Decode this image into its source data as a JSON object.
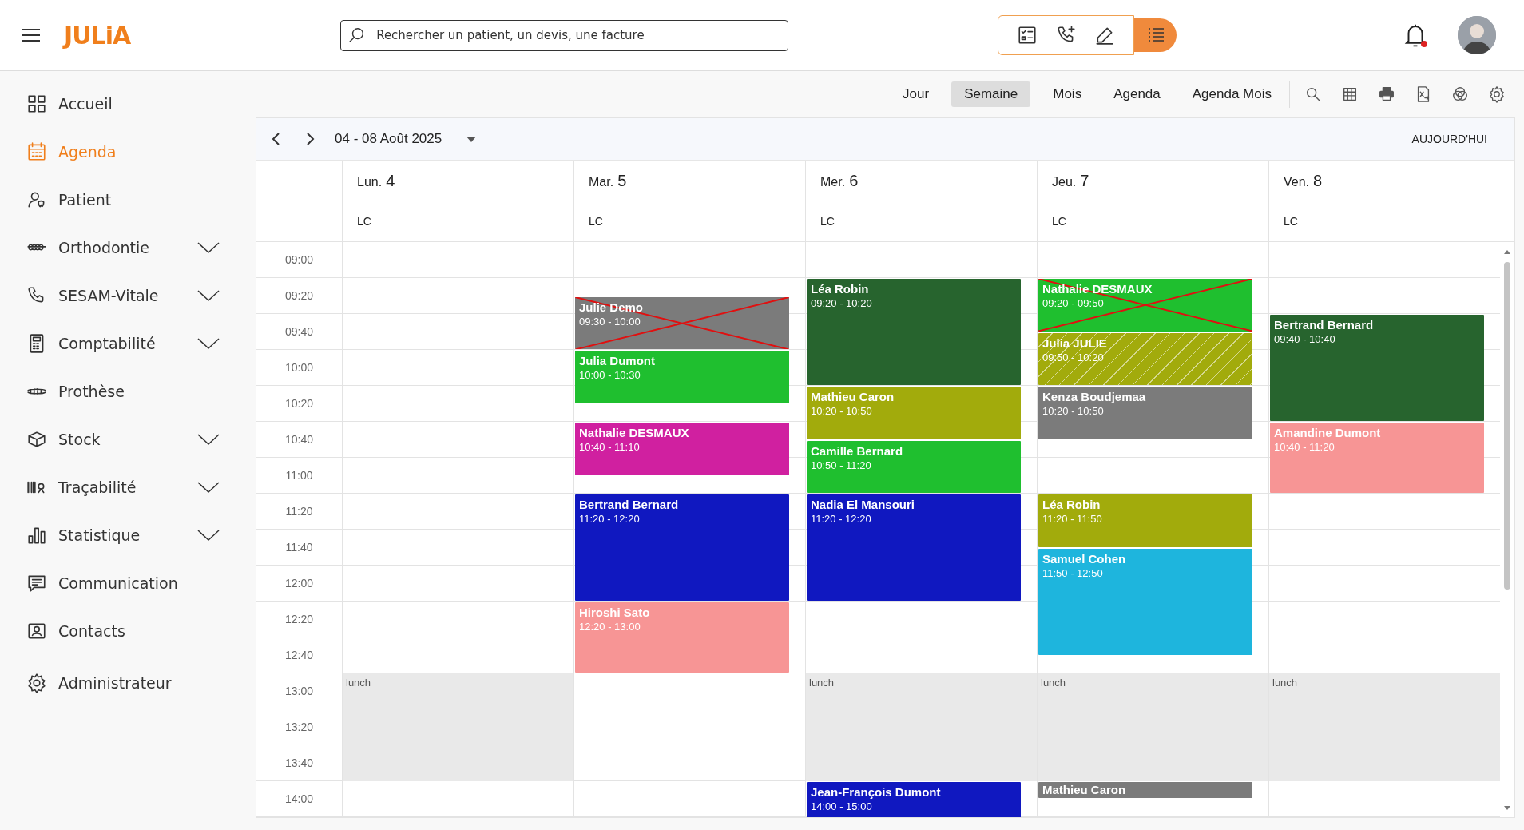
{
  "header": {
    "logo": "JULiA",
    "search": {
      "placeholder": "Rechercher un patient, un devis, une facture"
    },
    "notification_dot": true
  },
  "sidebar": {
    "items": [
      {
        "label": "Accueil",
        "selected": false,
        "expandable": false
      },
      {
        "label": "Agenda",
        "selected": true,
        "expandable": false
      },
      {
        "label": "Patient",
        "selected": false,
        "expandable": false
      },
      {
        "label": "Orthodontie",
        "selected": false,
        "expandable": true
      },
      {
        "label": "SESAM-Vitale",
        "selected": false,
        "expandable": true
      },
      {
        "label": "Comptabilité",
        "selected": false,
        "expandable": true
      },
      {
        "label": "Prothèse",
        "selected": false,
        "expandable": false
      },
      {
        "label": "Stock",
        "selected": false,
        "expandable": true
      },
      {
        "label": "Traçabilité",
        "selected": false,
        "expandable": true
      },
      {
        "label": "Statistique",
        "selected": false,
        "expandable": true
      },
      {
        "label": "Communication",
        "selected": false,
        "expandable": false
      },
      {
        "label": "Contacts",
        "selected": false,
        "expandable": false
      }
    ],
    "footer_items": [
      {
        "label": "Administrateur",
        "selected": false,
        "expandable": false
      }
    ]
  },
  "views": [
    {
      "label": "Jour",
      "selected": false
    },
    {
      "label": "Semaine",
      "selected": true
    },
    {
      "label": "Mois",
      "selected": false
    },
    {
      "label": "Agenda",
      "selected": false
    },
    {
      "label": "Agenda Mois",
      "selected": false
    }
  ],
  "nav": {
    "range": "04 - 08 Août 2025",
    "today": "AUJOURD'HUI"
  },
  "calendar": {
    "times": [
      "09:00",
      "09:20",
      "09:40",
      "10:00",
      "10:20",
      "10:40",
      "11:00",
      "11:20",
      "11:40",
      "12:00",
      "12:20",
      "12:40",
      "13:00",
      "13:20",
      "13:40",
      "14:00"
    ],
    "days": [
      {
        "weekday": "Lun.",
        "date": "4",
        "resource": "LC",
        "lunch": "lunch"
      },
      {
        "weekday": "Mar.",
        "date": "5",
        "resource": "LC",
        "events": [
          {
            "name": "Julie Demo",
            "time": "09:30 - 10:00",
            "color": "#7b7b7b",
            "cancelled": true,
            "hatched": false
          },
          {
            "name": "Julia Dumont",
            "time": "10:00 - 10:30",
            "color": "#1fbf2f",
            "cancelled": false,
            "hatched": false
          },
          {
            "name": "Nathalie DESMAUX",
            "time": "10:40 - 11:10",
            "color": "#d020a0",
            "cancelled": false,
            "hatched": false
          },
          {
            "name": "Bertrand Bernard",
            "time": "11:20 - 12:20",
            "color": "#1018c0",
            "cancelled": false,
            "hatched": false
          },
          {
            "name": "Hiroshi Sato",
            "time": "12:20 - 13:00",
            "color": "#f79595",
            "cancelled": false,
            "hatched": false
          }
        ]
      },
      {
        "weekday": "Mer.",
        "date": "6",
        "resource": "LC",
        "lunch": "lunch",
        "events": [
          {
            "name": "Léa Robin",
            "time": "09:20 - 10:20",
            "color": "#27642e",
            "cancelled": false,
            "hatched": false
          },
          {
            "name": "Mathieu Caron",
            "time": "10:20 - 10:50",
            "color": "#a2ab0c",
            "cancelled": false,
            "hatched": false
          },
          {
            "name": "Camille Bernard",
            "time": "10:50 - 11:20",
            "color": "#1fbf2f",
            "cancelled": false,
            "hatched": false
          },
          {
            "name": "Nadia El Mansouri",
            "time": "11:20 - 12:20",
            "color": "#1018c0",
            "cancelled": false,
            "hatched": false
          },
          {
            "name": "Jean-François Dumont",
            "time": "14:00 - 15:00",
            "color": "#1018c0",
            "cancelled": false,
            "hatched": false
          }
        ]
      },
      {
        "weekday": "Jeu.",
        "date": "7",
        "resource": "LC",
        "lunch": "lunch",
        "events": [
          {
            "name": "Nathalie DESMAUX",
            "time": "09:20 - 09:50",
            "color": "#1fbf2f",
            "cancelled": true,
            "hatched": false
          },
          {
            "name": "Julia JULIE",
            "time": "09:50 - 10:20",
            "color": "#a2ab0c",
            "cancelled": false,
            "hatched": true
          },
          {
            "name": "Kenza Boudjemaa",
            "time": "10:20 - 10:50",
            "color": "#7b7b7b",
            "cancelled": false,
            "hatched": false
          },
          {
            "name": "Léa Robin",
            "time": "11:20 - 11:50",
            "color": "#a2ab0c",
            "cancelled": false,
            "hatched": false
          },
          {
            "name": "Samuel Cohen",
            "time": "11:50 - 12:50",
            "color": "#1eb5dd",
            "cancelled": false,
            "hatched": false
          },
          {
            "name": "Mathieu Caron",
            "kind": "compact",
            "color": "#7b7b7b",
            "cancelled": false,
            "hatched": false
          }
        ]
      },
      {
        "weekday": "Ven.",
        "date": "8",
        "resource": "LC",
        "lunch": "lunch",
        "events": [
          {
            "name": "Bertrand Bernard",
            "time": "09:40 - 10:40",
            "color": "#27642e",
            "cancelled": false,
            "hatched": false
          },
          {
            "name": "Amandine Dumont",
            "time": "10:40 - 11:20",
            "color": "#f79595",
            "cancelled": false,
            "hatched": false
          }
        ]
      }
    ]
  }
}
